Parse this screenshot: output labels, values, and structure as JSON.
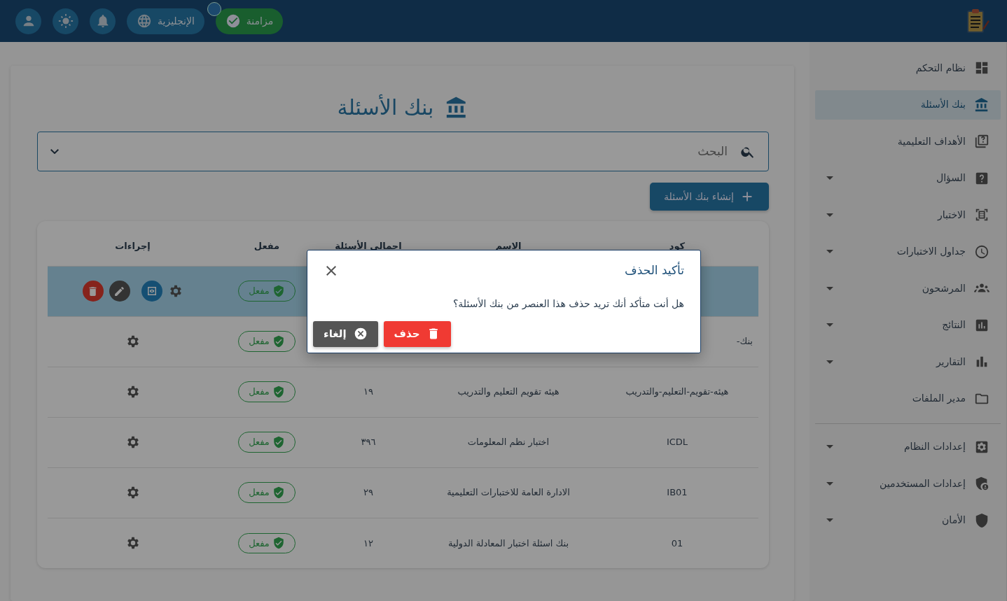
{
  "topbar": {
    "sync_button": "مزامنة",
    "language_button": "الإنجليزية"
  },
  "sidebar": {
    "sections": [
      {
        "items": [
          {
            "label": "نظام التحكم",
            "selected": false,
            "expandable": false
          },
          {
            "label": "بنك الأسئلة",
            "selected": true,
            "expandable": false
          },
          {
            "label": "الأهداف التعليمية",
            "selected": false,
            "expandable": false
          },
          {
            "label": "السؤال",
            "selected": false,
            "expandable": true
          },
          {
            "label": "الاختبار",
            "selected": false,
            "expandable": true
          },
          {
            "label": "جداول الاختبارات",
            "selected": false,
            "expandable": true
          },
          {
            "label": "المرشحون",
            "selected": false,
            "expandable": true
          },
          {
            "label": "النتائج",
            "selected": false,
            "expandable": true
          },
          {
            "label": "التقارير",
            "selected": false,
            "expandable": true
          },
          {
            "label": "مدير الملفات",
            "selected": false,
            "expandable": false
          }
        ]
      },
      {
        "items": [
          {
            "label": "إعدادات النظام",
            "selected": false,
            "expandable": true
          },
          {
            "label": "إعدادات المستخدمين",
            "selected": false,
            "expandable": true
          },
          {
            "label": "الأمان",
            "selected": false,
            "expandable": true
          }
        ]
      }
    ]
  },
  "page": {
    "title": "بنك الأسئلة",
    "search": {
      "placeholder": "البحث"
    },
    "create_button": "إنشاء بنك الأسئلة",
    "table": {
      "columns": [
        "كود",
        "الاسم",
        "اجمالي الأسئلة",
        "مفعل",
        "إجراءات"
      ],
      "rows": [
        {
          "selected": true,
          "status": "مفعل",
          "enabled": true
        },
        {
          "selected": false,
          "code": "بنك-",
          "cut": true,
          "status": "مفعل",
          "enabled": true
        },
        {
          "selected": false,
          "code": "هيئه-تقويم-التعليم-والتدريب",
          "name": "هيئه تقويم التعليم والتدريب",
          "count": "١٩",
          "status": "مفعل",
          "enabled": true
        },
        {
          "selected": false,
          "code": "ICDL",
          "name": "اختبار نظم المعلومات",
          "count": "٣٩٦",
          "status": "مفعل",
          "enabled": true
        },
        {
          "selected": false,
          "code": "IB01",
          "name": "الادارة العامة للاختبارات التعليمية",
          "count": "٢٩",
          "status": "مفعل",
          "enabled": true
        },
        {
          "selected": false,
          "code": "01",
          "name": "بنك اسئلة اختبار المعادلة الدولية",
          "count": "١٢",
          "status": "مفعل",
          "enabled": true
        }
      ]
    }
  },
  "dialog": {
    "title": "تأكيد الحذف",
    "message": "هل أنت متأكد أنك تريد حذف هذا العنصر من بنك الأسئلة؟",
    "buttons": [
      {
        "label": "حذف",
        "kind": "danger"
      },
      {
        "label": "إلغاء",
        "kind": "cancel"
      }
    ]
  }
}
